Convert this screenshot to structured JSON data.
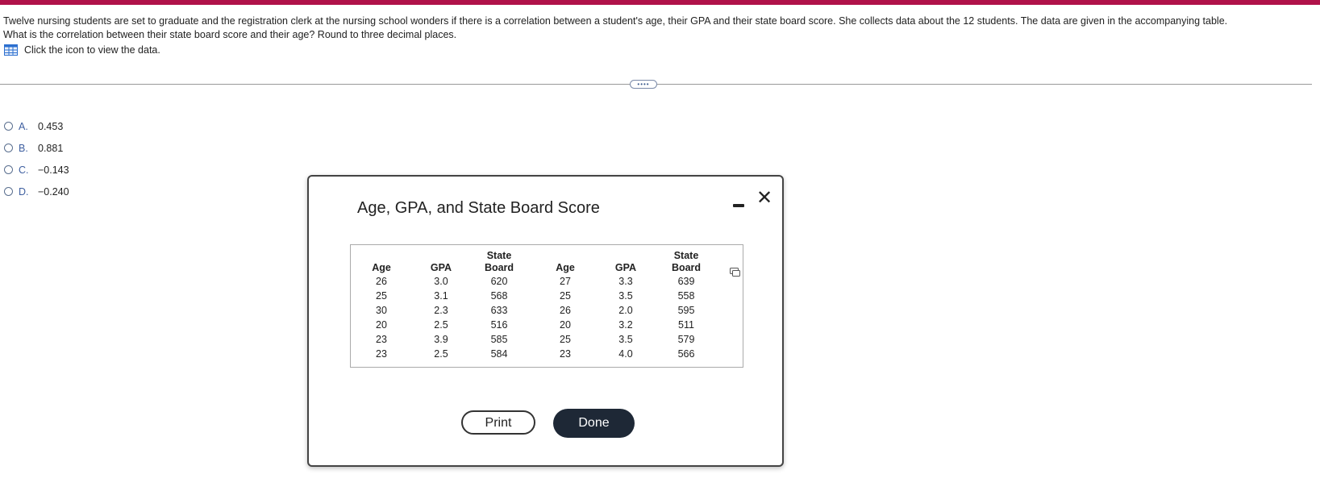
{
  "question": {
    "line1": "Twelve nursing students are set to graduate and the registration clerk at the nursing school wonders if there is a correlation between a student's age, their GPA and their state board score. She collects data about the 12 students. The data are given in the accompanying table.",
    "line2": "What is the correlation between their state board score and their age? Round to three decimal places.",
    "view_data": "Click the icon to view the data.",
    "view_data_icon": "table-icon"
  },
  "more_button": "••••",
  "options": [
    {
      "letter": "A.",
      "value": "0.453"
    },
    {
      "letter": "B.",
      "value": "0.881"
    },
    {
      "letter": "C.",
      "value": "−0.143"
    },
    {
      "letter": "D.",
      "value": "−0.240"
    }
  ],
  "dialog": {
    "title": "Age, GPA, and State Board Score",
    "columns": [
      {
        "header1": "",
        "header2": "Age",
        "values": [
          "26",
          "25",
          "30",
          "20",
          "23",
          "23"
        ]
      },
      {
        "header1": "",
        "header2": "GPA",
        "values": [
          "3.0",
          "3.1",
          "2.3",
          "2.5",
          "3.9",
          "2.5"
        ]
      },
      {
        "header1": "State",
        "header2": "Board",
        "values": [
          "620",
          "568",
          "633",
          "516",
          "585",
          "584"
        ]
      },
      {
        "header1": "",
        "header2": "Age",
        "values": [
          "27",
          "25",
          "26",
          "20",
          "25",
          "23"
        ]
      },
      {
        "header1": "",
        "header2": "GPA",
        "values": [
          "3.3",
          "3.5",
          "2.0",
          "3.2",
          "3.5",
          "4.0"
        ]
      },
      {
        "header1": "State",
        "header2": "Board",
        "values": [
          "639",
          "558",
          "595",
          "511",
          "579",
          "566"
        ]
      }
    ],
    "print_label": "Print",
    "done_label": "Done",
    "close_glyph": "✕",
    "minimize_icon": "minimize-icon",
    "copy_icon": "copy-icon"
  },
  "colors": {
    "accent": "#b0124a",
    "link": "#3e5fa0",
    "done_bg": "#1e2836"
  }
}
